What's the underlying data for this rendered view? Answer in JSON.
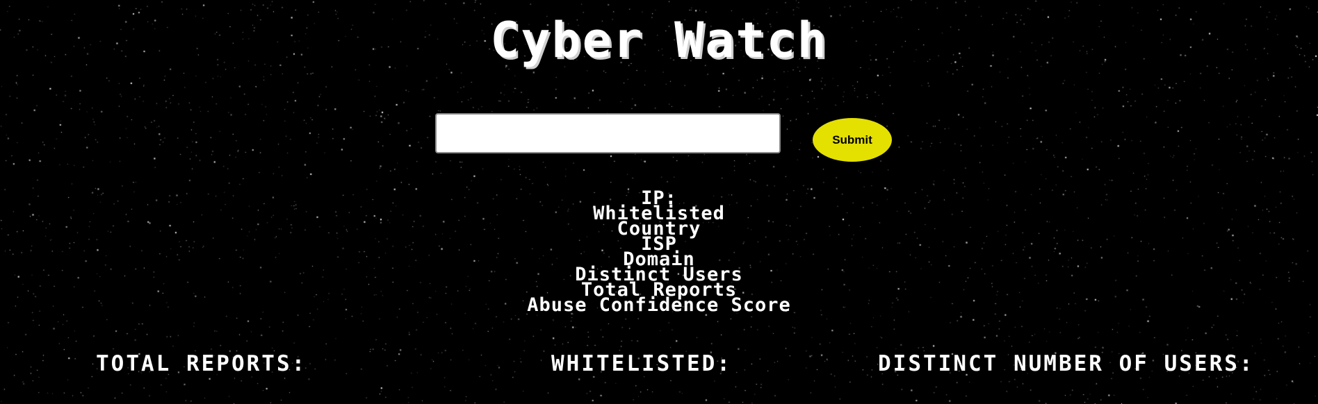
{
  "page": {
    "title": "Cyber Watch",
    "background_color": "#000000",
    "star_color": "#ffffff"
  },
  "search": {
    "value": "",
    "placeholder": "",
    "submit_label": "Submit",
    "submit_color": "#e4e000"
  },
  "info_fields": [
    "IP:",
    "Whitelisted",
    "Country",
    "ISP",
    "Domain",
    "Distinct Users",
    "Total Reports",
    "Abuse Confidence Score"
  ],
  "stats": {
    "total_reports_label": "TOTAL REPORTS:",
    "whitelisted_label": "WHITELISTED:",
    "distinct_users_label": "DISTINCT NUMBER OF USERS:"
  }
}
